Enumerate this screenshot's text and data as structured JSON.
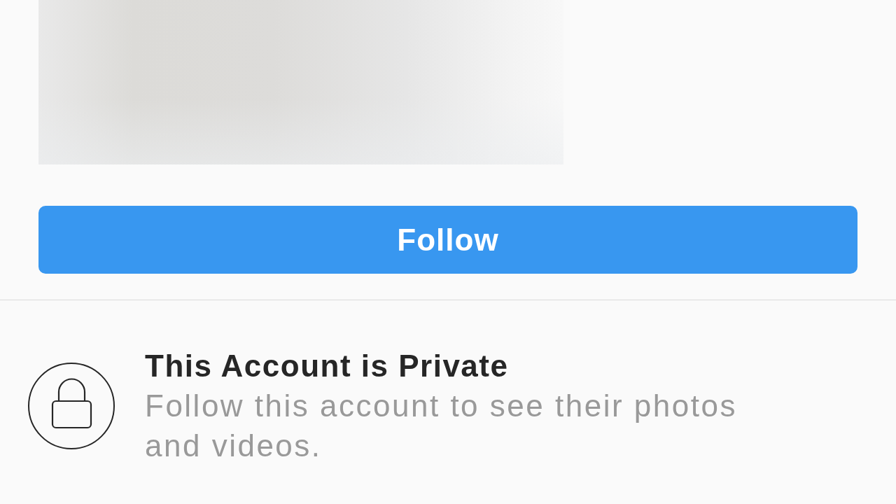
{
  "follow_button": {
    "label": "Follow"
  },
  "private_notice": {
    "title": "This Account is Private",
    "message": "Follow this account to see their photos and videos."
  }
}
